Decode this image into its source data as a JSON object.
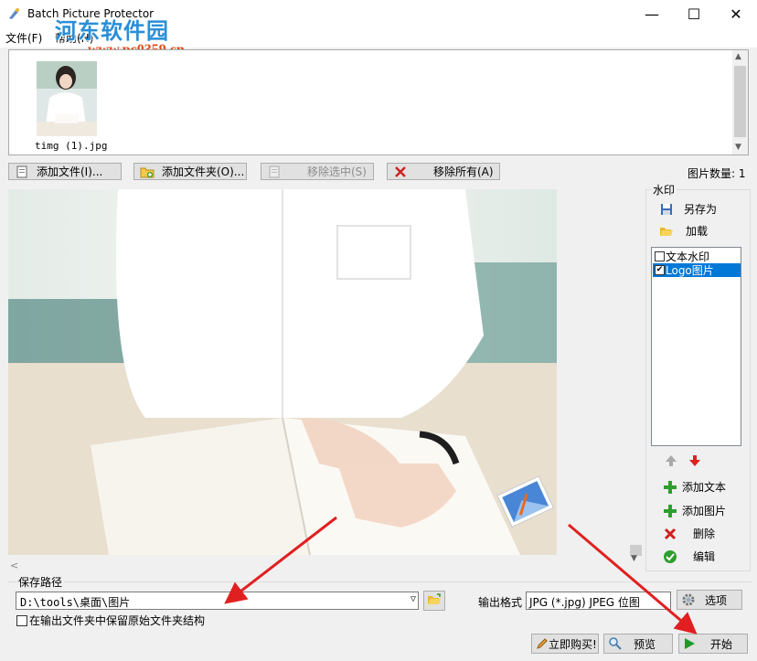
{
  "window": {
    "title": "Batch Picture Protector",
    "minimize_glyph": "—",
    "maximize_glyph": "☐",
    "close_glyph": "✕"
  },
  "site_watermark": {
    "name": "河东软件园",
    "url": "www.pc0359.cn"
  },
  "menu": {
    "items": [
      "文件(F)",
      "帮助(H)"
    ]
  },
  "file_list": {
    "items": [
      {
        "name": "timg (1).jpg"
      }
    ]
  },
  "toolbar": {
    "add_file": "添加文件(I)...",
    "add_folder": "添加文件夹(O)...",
    "remove_selected": "移除选中(S)",
    "remove_all": "移除所有(A)",
    "image_count": "图片数量: 1"
  },
  "watermark_panel": {
    "title": "水印",
    "save_as": "另存为",
    "load": "加载",
    "list": [
      {
        "label": "文本水印",
        "checked": false,
        "selected": false
      },
      {
        "label": "Logo图片",
        "checked": true,
        "selected": true
      }
    ],
    "add_text": "添加文本",
    "add_image": "添加图片",
    "delete": "删除",
    "edit": "编辑"
  },
  "output": {
    "save_path_label": "保存路径",
    "save_path_value": "D:\\tools\\桌面\\图片",
    "format_label": "输出格式",
    "format_value": "JPG (*.jpg) JPEG 位图",
    "options_label": "选项",
    "keep_structure_label": "在输出文件夹中保留原始文件夹结构",
    "keep_structure_checked": false
  },
  "footer": {
    "buy_label": "立即购买!",
    "preview_label": "预览",
    "start_label": "开始"
  },
  "colors": {
    "accent": "#0078d7",
    "arrow_red": "#e02020",
    "watermark_blue": "#2a8fd8",
    "url_orange": "#e04a1a"
  }
}
